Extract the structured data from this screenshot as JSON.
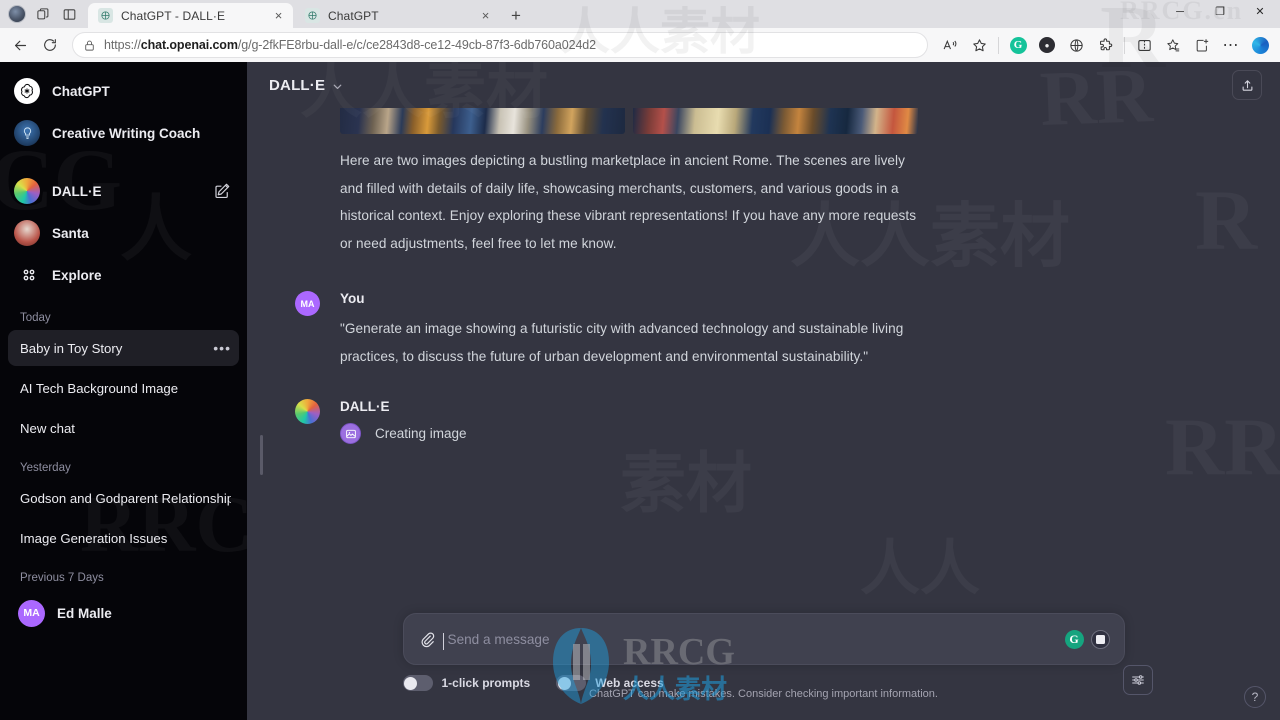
{
  "browser": {
    "tabs": [
      {
        "title": "ChatGPT - DALL·E",
        "active": true,
        "close_label": "×"
      },
      {
        "title": "ChatGPT",
        "active": false,
        "close_label": "×"
      }
    ],
    "newtab_label": "+",
    "url_prefix": "https://",
    "url_domain": "chat.openai.com",
    "url_path": "/g/g-2fkFE8rbu-dall-e/c/ce2843d8-ce12-49cb-87f3-6db760a024d2",
    "window_controls": {
      "minimize": "─",
      "maximize": "❐",
      "close": "✕"
    },
    "toolbar_icons": [
      "read-aloud-icon",
      "favorite-star-icon",
      "grammarly-icon",
      "extension-dark-icon",
      "globe-icon",
      "puzzle-icon",
      "split-screen-icon",
      "collections-icon",
      "add-collection-icon",
      "more-options-icon",
      "copilot-icon"
    ],
    "left_icons": [
      "profile-avatar-icon",
      "tab-copy-icon",
      "vertical-tabs-icon"
    ],
    "nav_icons": [
      "back-arrow-icon",
      "reload-icon",
      "lock-icon"
    ]
  },
  "sidebar": {
    "gpts": [
      {
        "label": "ChatGPT",
        "avatar": "chatgpt-logo-icon"
      },
      {
        "label": "Creative Writing Coach",
        "avatar": "creative-writing-coach-icon"
      },
      {
        "label": "DALL·E",
        "avatar": "dalle-logo-icon",
        "has_edit": true
      },
      {
        "label": "Santa",
        "avatar": "santa-icon"
      }
    ],
    "explore": {
      "label": "Explore",
      "icon": "grid-icon"
    },
    "sections": [
      {
        "label": "Today",
        "items": [
          {
            "title": "Baby in Toy Story",
            "active": true,
            "menu": "•••"
          },
          {
            "title": "AI Tech Background Image",
            "active": false
          },
          {
            "title": "New chat",
            "active": false
          }
        ]
      },
      {
        "label": "Yesterday",
        "items": [
          {
            "title": "Godson and Godparent Relationship",
            "active": false
          },
          {
            "title": "Image Generation Issues",
            "active": false
          }
        ]
      },
      {
        "label": "Previous 7 Days",
        "items": []
      }
    ],
    "user": {
      "initials": "MA",
      "name": "Ed Malle"
    }
  },
  "main": {
    "model_name": "DALL·E",
    "share_icon": "share-upload-icon",
    "messages": [
      {
        "role": "assistant",
        "has_images": true,
        "images": [
          "generated-image-1",
          "generated-image-2"
        ],
        "text": "Here are two images depicting a bustling marketplace in ancient Rome. The scenes are lively and filled with details of daily life, showcasing merchants, customers, and various goods in a historical context. Enjoy exploring these vibrant representations! If you have any more requests or need adjustments, feel free to let me know."
      },
      {
        "role": "user",
        "name": "You",
        "initials": "MA",
        "text": "\"Generate an image showing a futuristic city with advanced technology and sustainable living practices, to discuss the future of urban development and environmental sustainability.\""
      },
      {
        "role": "assistant",
        "name": "DALL·E",
        "status": "Creating image",
        "status_icon": "image-generation-icon"
      }
    ]
  },
  "composer": {
    "attach_icon": "paperclip-icon",
    "placeholder": "Send a message",
    "value": "",
    "grammarly_icon": "grammarly-icon",
    "stop_icon": "stop-generating-icon"
  },
  "bottom_bar": {
    "toggles": [
      {
        "label": "1-click prompts",
        "on": false
      },
      {
        "label": "Web access",
        "on": false
      }
    ],
    "settings_icon": "sliders-settings-icon",
    "footnote": "ChatGPT can make mistakes. Consider checking important information.",
    "help_label": "?"
  },
  "colors": {
    "page_bg": "#343541",
    "sidebar_bg": "#050509",
    "accent_purple": "#ab68ff",
    "grammarly_green": "#15a47f",
    "text_primary": "#ececf1",
    "text_secondary": "#8e8ea0"
  }
}
